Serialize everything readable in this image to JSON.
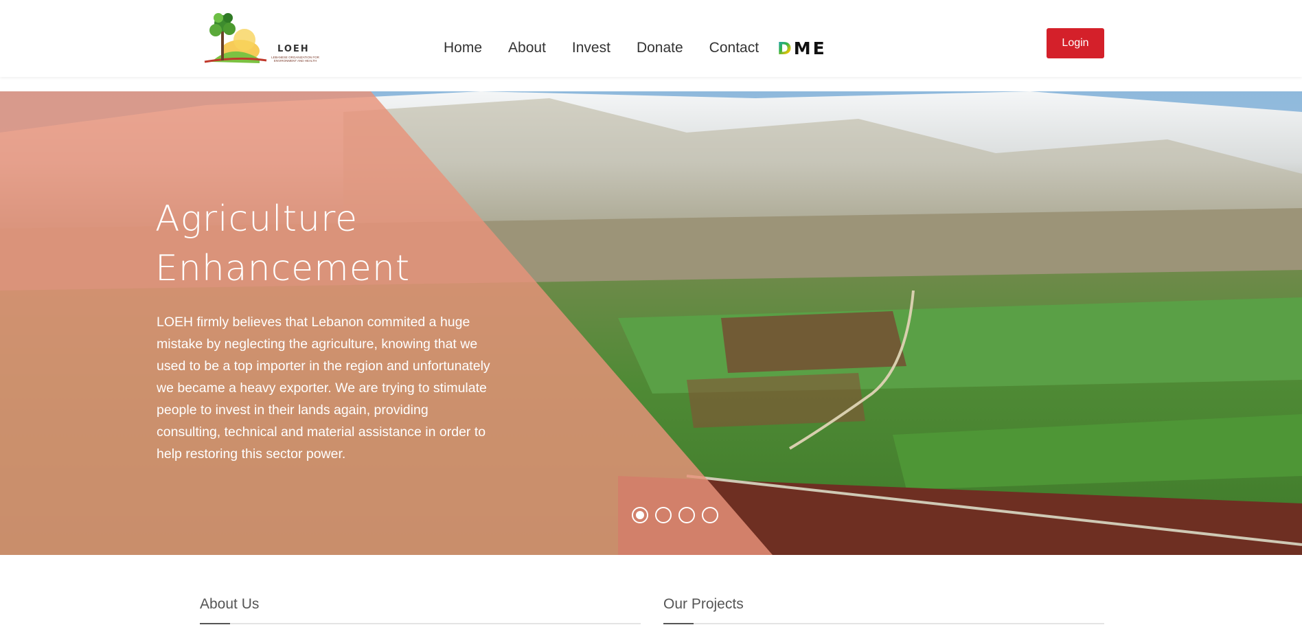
{
  "header": {
    "logo_text": "LOEH",
    "logo_subtitle": "LEBANESE ORGANIZATION FOR ENVIRONMENT AND HEALTH",
    "nav": [
      "Home",
      "About",
      "Invest",
      "Donate",
      "Contact"
    ],
    "dme_d": "D",
    "dme_me": "ME",
    "login_label": "Login"
  },
  "hero": {
    "title_line1": "Agriculture",
    "title_line2": "Enhancement",
    "text": "LOEH firmly believes that Lebanon commited a huge mistake by neglecting the agriculture, knowing that we used to be a top importer in the region and unfortunately we became a heavy exporter. We are trying to stimulate people to invest in their lands again, providing consulting, technical and material assistance in order to help restoring this sector power.",
    "slide_count": 4,
    "active_slide": 1
  },
  "sections": {
    "about_title": "About Us",
    "projects_title": "Our Projects"
  },
  "colors": {
    "login_bg": "#d4202a",
    "overlay": "#e8927a"
  }
}
